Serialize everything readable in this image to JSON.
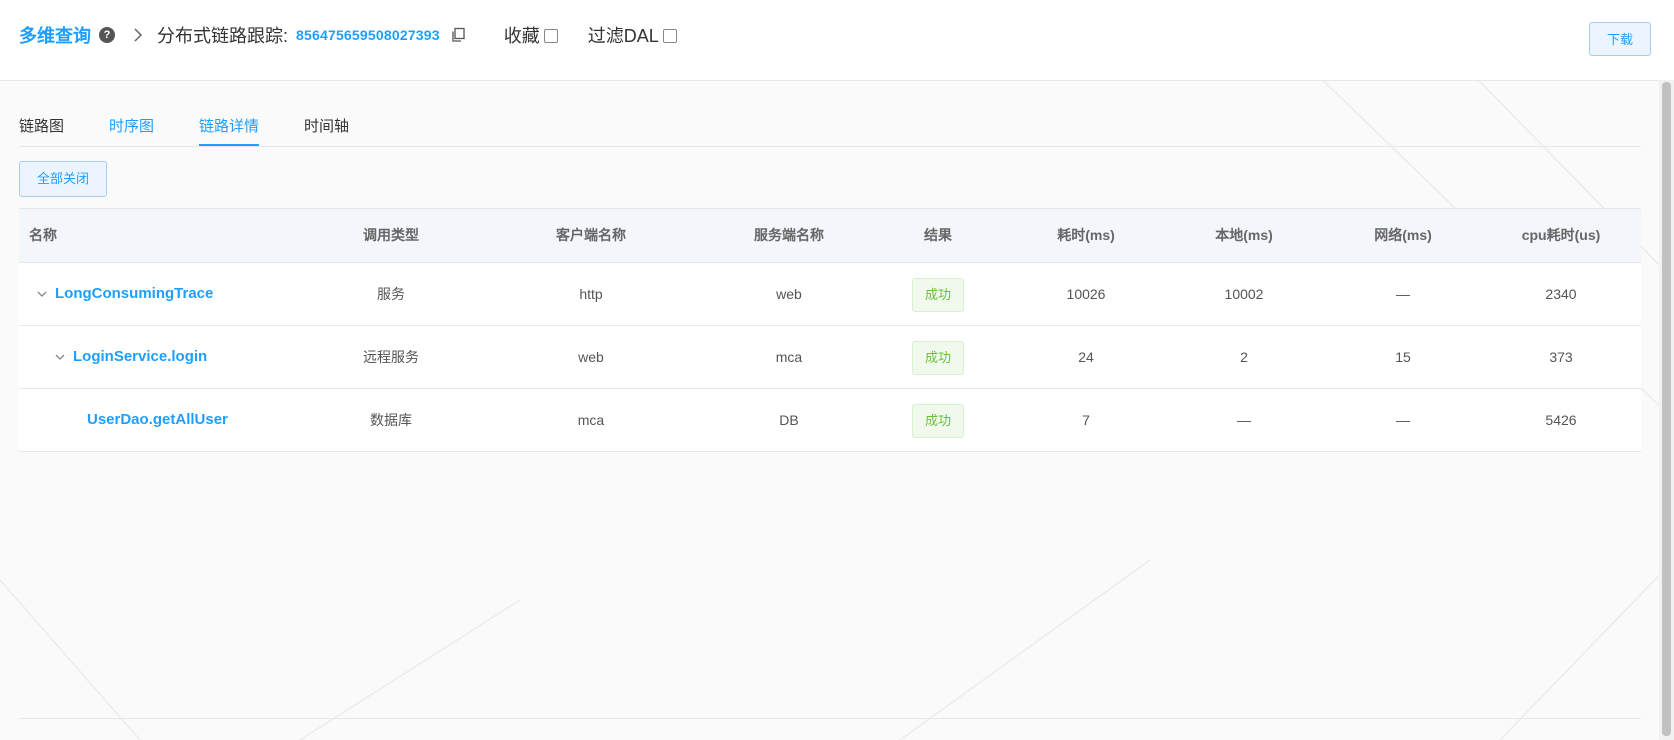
{
  "header": {
    "root": "多维查询",
    "page_label": "分布式链路跟踪:",
    "trace_id": "856475659508027393",
    "favorite_label": "收藏",
    "filter_label": "过滤DAL",
    "download_label": "下载"
  },
  "tabs": [
    {
      "label": "链路图"
    },
    {
      "label": "时序图"
    },
    {
      "label": "链路详情"
    },
    {
      "label": "时间轴"
    }
  ],
  "collapse_all_label": "全部关闭",
  "table": {
    "columns": [
      "名称",
      "调用类型",
      "客户端名称",
      "服务端名称",
      "结果",
      "耗时(ms)",
      "本地(ms)",
      "网络(ms)",
      "cpu耗时(us)"
    ],
    "rows": [
      {
        "name": "LongConsumingTrace",
        "type": "服务",
        "client": "http",
        "server": "web",
        "result": "成功",
        "duration": "10026",
        "local": "10002",
        "network": "—",
        "cpu": "2340"
      },
      {
        "name": "LoginService.login",
        "type": "远程服务",
        "client": "web",
        "server": "mca",
        "result": "成功",
        "duration": "24",
        "local": "2",
        "network": "15",
        "cpu": "373"
      },
      {
        "name": "UserDao.getAllUser",
        "type": "数据库",
        "client": "mca",
        "server": "DB",
        "result": "成功",
        "duration": "7",
        "local": "—",
        "network": "—",
        "cpu": "5426"
      }
    ]
  },
  "colors": {
    "accent": "#1e9fff",
    "success": "#67c23a"
  },
  "icons": [
    "help-icon",
    "chevron-right-icon",
    "copy-icon",
    "caret-down-icon"
  ]
}
